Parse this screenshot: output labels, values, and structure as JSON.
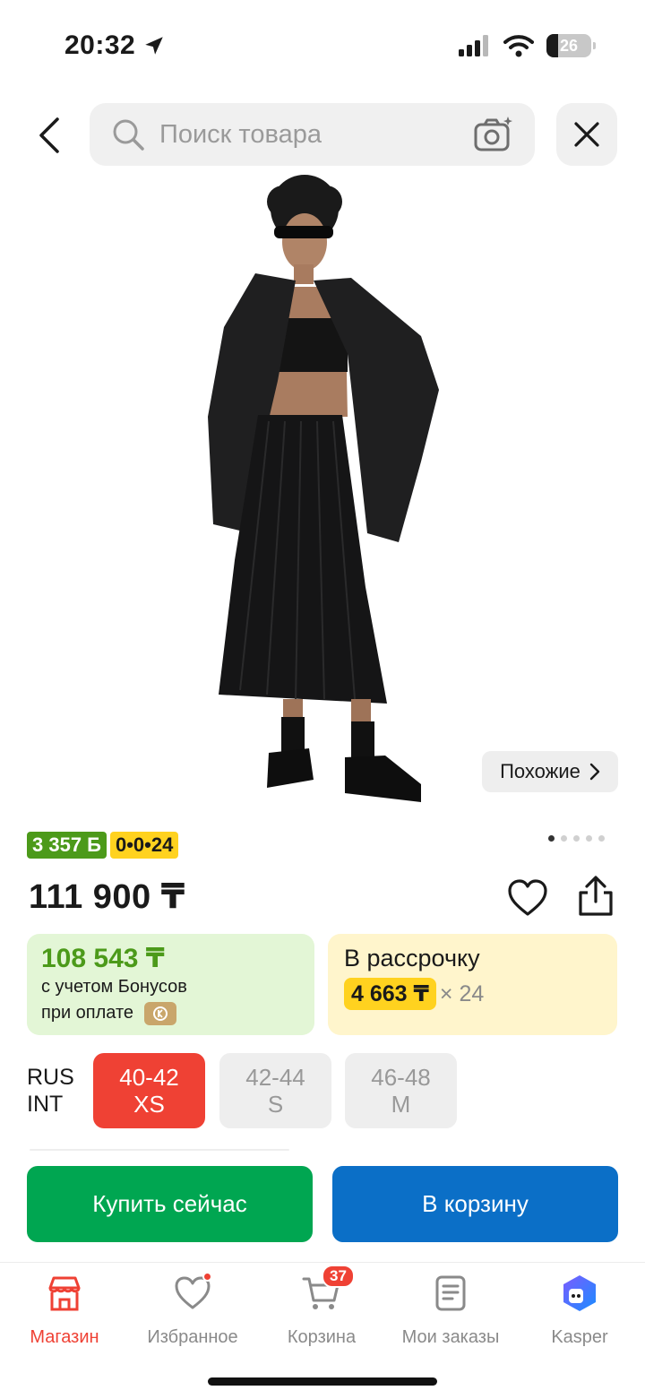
{
  "status_bar": {
    "time": "20:32",
    "battery": "26"
  },
  "search": {
    "placeholder": "Поиск товара"
  },
  "product": {
    "similar_label": "Похожие",
    "bonus_badge": "3 357 Б",
    "installment_badge": "0•0•24",
    "price": "111 900 ₸",
    "gallery": {
      "total": 5,
      "active": 1
    }
  },
  "bonus_card": {
    "amount": "108 543 ₸",
    "line1": "с учетом Бонусов",
    "line2": "при оплате"
  },
  "credit_card": {
    "title": "В рассрочку",
    "amount": "4 663 ₸",
    "multiplier": "× 24"
  },
  "sizes": {
    "label_line1": "RUS",
    "label_line2": "INT",
    "options": [
      {
        "rus": "40-42",
        "int": "XS",
        "selected": true
      },
      {
        "rus": "42-44",
        "int": "S",
        "selected": false
      },
      {
        "rus": "46-48",
        "int": "M",
        "selected": false
      }
    ]
  },
  "actions": {
    "buy_now": "Купить сейчас",
    "add_to_cart": "В корзину"
  },
  "tabbar": {
    "items": [
      {
        "label": "Магазин",
        "icon": "shop-icon",
        "active": true
      },
      {
        "label": "Избранное",
        "icon": "heart-icon",
        "active": false
      },
      {
        "label": "Корзина",
        "icon": "cart-icon",
        "active": false,
        "badge": "37"
      },
      {
        "label": "Мои заказы",
        "icon": "orders-icon",
        "active": false
      },
      {
        "label": "Kasper",
        "icon": "kasper-icon",
        "active": false
      }
    ]
  },
  "colors": {
    "accent_red": "#ef4134",
    "buy_green": "#00a651",
    "cart_blue": "#0b6fc7",
    "bonus_green": "#4c9a1a",
    "installment_yellow": "#ffd21f"
  }
}
